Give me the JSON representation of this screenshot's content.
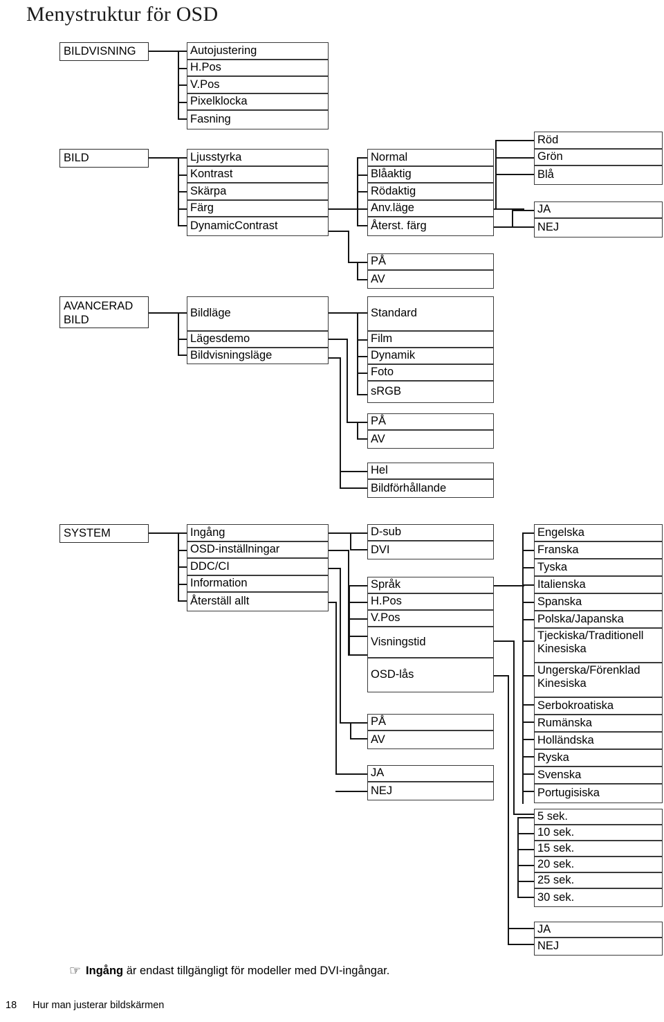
{
  "page_title": "Menystruktur för OSD",
  "sections": {
    "bildvisning": {
      "root": "BILDVISNING",
      "items": [
        "Autojustering",
        "H.Pos",
        "V.Pos",
        "Pixelklocka",
        "Fasning"
      ]
    },
    "bild": {
      "root": "BILD",
      "items": [
        "Ljusstyrka",
        "Kontrast",
        "Skärpa",
        "Färg",
        "DynamicContrast"
      ],
      "farg_options": [
        "Normal",
        "Blåaktig",
        "Rödaktig",
        "Anv.läge",
        "Återst. färg"
      ],
      "anvlage_options": [
        "Röd",
        "Grön",
        "Blå"
      ],
      "aterst_options": [
        "JA",
        "NEJ"
      ],
      "dynamiccontrast_options": [
        "PÅ",
        "AV"
      ]
    },
    "avancerad_bild": {
      "root": "AVANCERAD\nBILD",
      "items": [
        "Bildläge",
        "Lägesdemo",
        "Bildvisningsläge"
      ],
      "bildlage_options": [
        "Standard",
        "Film",
        "Dynamik",
        "Foto",
        "sRGB"
      ],
      "lagesdemo_options": [
        "PÅ",
        "AV"
      ],
      "bildvisningslage_options": [
        "Hel",
        "Bildförhållande"
      ]
    },
    "system": {
      "root": "SYSTEM",
      "items": [
        "Ingång",
        "OSD-inställningar",
        "DDC/CI",
        "Information",
        "Återställ allt"
      ],
      "ingang_options": [
        "D-sub",
        "DVI"
      ],
      "osd_options": [
        "Språk",
        "H.Pos",
        "V.Pos",
        "Visningstid",
        "OSD-lås"
      ],
      "ddcci_options": [
        "PÅ",
        "AV"
      ],
      "aterstall_options": [
        "JA",
        "NEJ"
      ],
      "sprak_options": [
        "Engelska",
        "Franska",
        "Tyska",
        "Italienska",
        "Spanska",
        "Polska/Japanska",
        "Tjeckiska/Traditionell Kinesiska",
        "Ungerska/Förenklad Kinesiska",
        "Serbokroatiska",
        "Rumänska",
        "Holländska",
        "Ryska",
        "Svenska",
        "Portugisiska"
      ],
      "visningstid_options": [
        "5 sek.",
        "10 sek.",
        "15 sek.",
        "20 sek.",
        "25 sek.",
        "30 sek."
      ],
      "osdlas_options": [
        "JA",
        "NEJ"
      ]
    }
  },
  "note": {
    "icon": "pointing-hand-icon",
    "icon_glyph": "☞",
    "bold_term": "Ingång",
    "text": " är endast tillgängligt för modeller med DVI-ingångar."
  },
  "footer": {
    "page_number": "18",
    "chapter": "Hur man justerar bildskärmen"
  },
  "colors": {
    "ink": "#141414",
    "box_border": "#3a3a3a",
    "page_bg": "#ffffff"
  }
}
